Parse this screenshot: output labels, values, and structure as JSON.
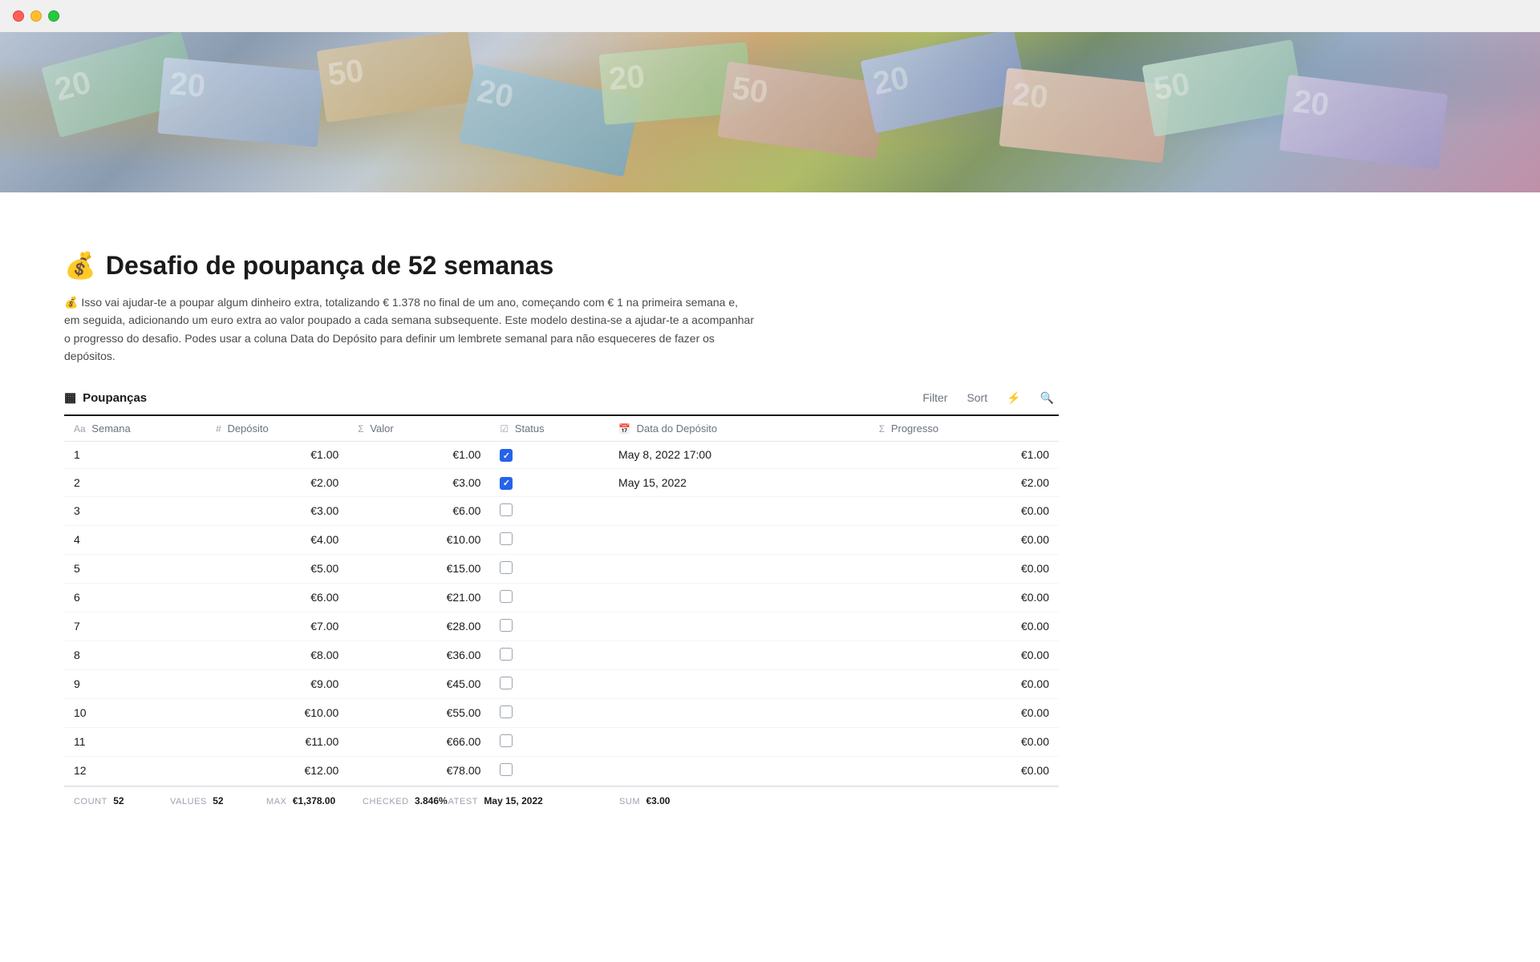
{
  "window": {
    "title": "Desafio de poupança de 52 semanas"
  },
  "hero": {
    "alt": "Euro banknotes"
  },
  "page": {
    "icon": "💰",
    "title": "Desafio de poupança de 52 semanas",
    "description": "💰 Isso vai ajudar-te a poupar algum dinheiro extra, totalizando € 1.378 no final de um ano, começando com € 1 na primeira semana e, em seguida, adicionando um euro extra ao valor poupado a cada semana subsequente. Este modelo destina-se a ajudar-te a acompanhar o progresso do desafio. Podes usar a coluna Data do Depósito para definir um lembrete semanal para não esqueceres de fazer os depósitos."
  },
  "table": {
    "title": "Poupanças",
    "title_icon": "▦",
    "controls": {
      "filter": "Filter",
      "sort": "Sort",
      "lightning": "⚡",
      "search": "🔍"
    },
    "columns": [
      {
        "prefix": "Aa",
        "label": "Semana"
      },
      {
        "prefix": "#",
        "label": "Depósito"
      },
      {
        "prefix": "Σ",
        "label": "Valor"
      },
      {
        "prefix": "☑",
        "label": "Status"
      },
      {
        "prefix": "📅",
        "label": "Data do Depósito"
      },
      {
        "prefix": "Σ",
        "label": "Progresso"
      }
    ],
    "rows": [
      {
        "semana": "1",
        "deposito": "€1.00",
        "valor": "€1.00",
        "status": true,
        "data": "May 8, 2022 17:00",
        "progresso": "€1.00"
      },
      {
        "semana": "2",
        "deposito": "€2.00",
        "valor": "€3.00",
        "status": true,
        "data": "May 15, 2022",
        "progresso": "€2.00"
      },
      {
        "semana": "3",
        "deposito": "€3.00",
        "valor": "€6.00",
        "status": false,
        "data": "",
        "progresso": "€0.00"
      },
      {
        "semana": "4",
        "deposito": "€4.00",
        "valor": "€10.00",
        "status": false,
        "data": "",
        "progresso": "€0.00"
      },
      {
        "semana": "5",
        "deposito": "€5.00",
        "valor": "€15.00",
        "status": false,
        "data": "",
        "progresso": "€0.00"
      },
      {
        "semana": "6",
        "deposito": "€6.00",
        "valor": "€21.00",
        "status": false,
        "data": "",
        "progresso": "€0.00"
      },
      {
        "semana": "7",
        "deposito": "€7.00",
        "valor": "€28.00",
        "status": false,
        "data": "",
        "progresso": "€0.00"
      },
      {
        "semana": "8",
        "deposito": "€8.00",
        "valor": "€36.00",
        "status": false,
        "data": "",
        "progresso": "€0.00"
      },
      {
        "semana": "9",
        "deposito": "€9.00",
        "valor": "€45.00",
        "status": false,
        "data": "",
        "progresso": "€0.00"
      },
      {
        "semana": "10",
        "deposito": "€10.00",
        "valor": "€55.00",
        "status": false,
        "data": "",
        "progresso": "€0.00"
      },
      {
        "semana": "11",
        "deposito": "€11.00",
        "valor": "€66.00",
        "status": false,
        "data": "",
        "progresso": "€0.00"
      },
      {
        "semana": "12",
        "deposito": "€12.00",
        "valor": "€78.00",
        "status": false,
        "data": "",
        "progresso": "€0.00"
      }
    ],
    "footer": {
      "semana_label": "COUNT",
      "semana_value": "52",
      "deposito_label": "VALUES",
      "deposito_value": "52",
      "valor_label": "MAX",
      "valor_value": "€1,378.00",
      "status_label": "CHECKED",
      "status_value": "3.846%",
      "data_label": "LATEST",
      "data_value": "May 15, 2022",
      "progresso_label": "SUM",
      "progresso_value": "€3.00"
    }
  }
}
